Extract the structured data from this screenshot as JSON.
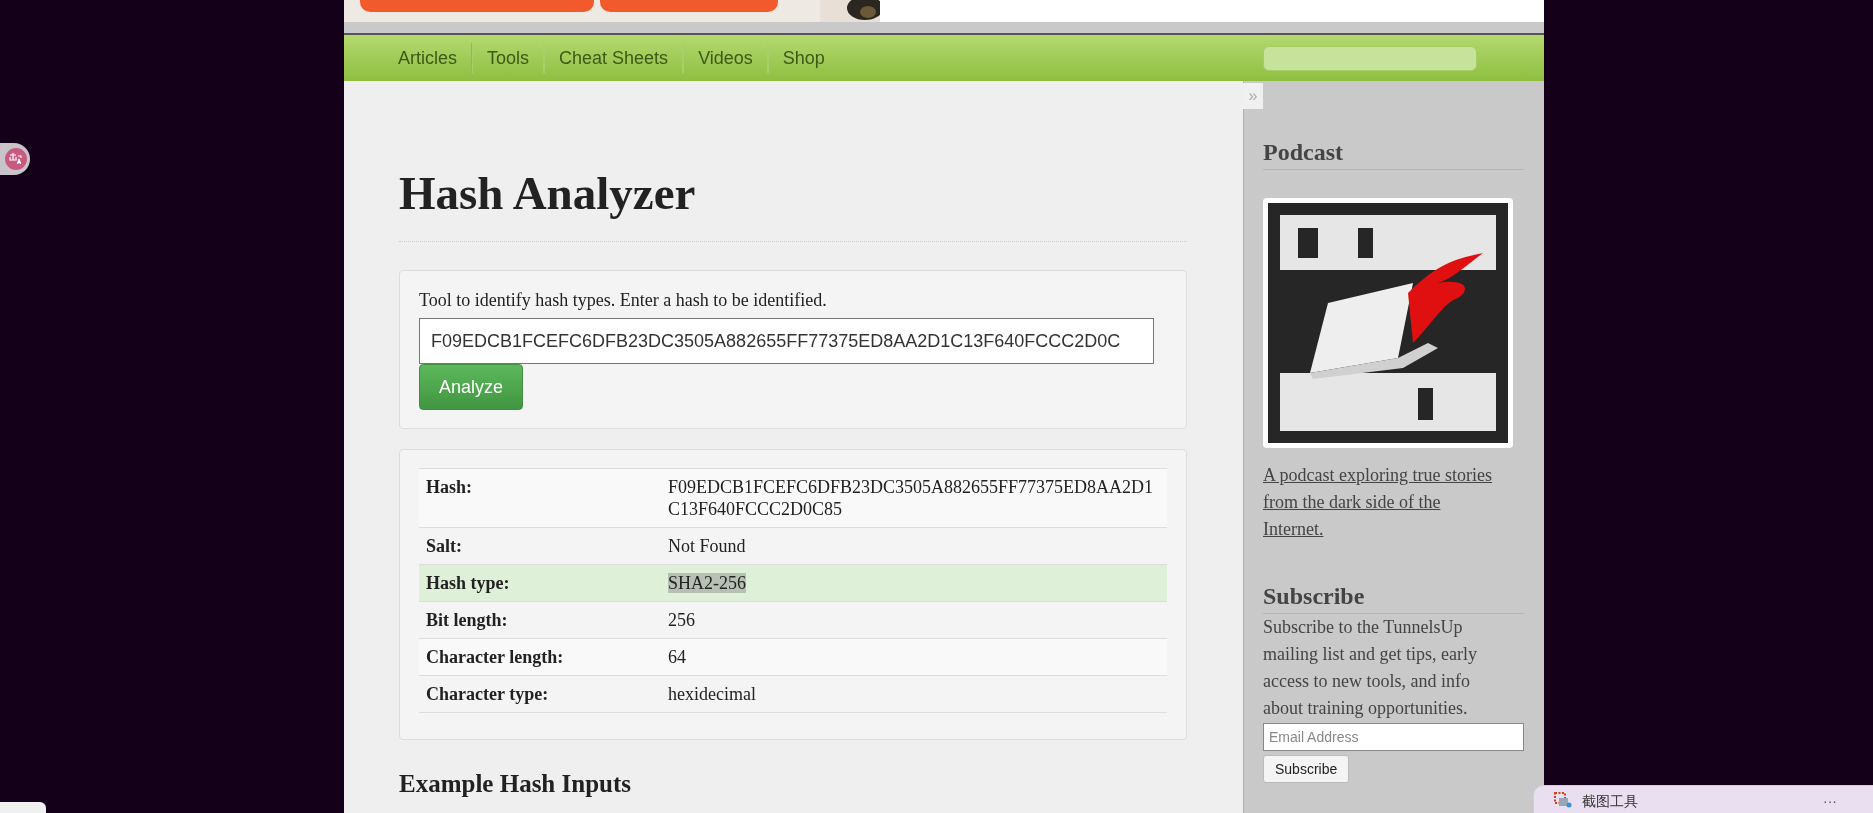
{
  "nav": {
    "items": [
      {
        "label": "Articles"
      },
      {
        "label": "Tools"
      },
      {
        "label": "Cheat Sheets"
      },
      {
        "label": "Videos"
      },
      {
        "label": "Shop"
      }
    ]
  },
  "page": {
    "title": "Hash Analyzer",
    "form": {
      "instructions": "Tool to identify hash types. Enter a hash to be identified.",
      "hash_value": "F09EDCB1FCEFC6DFB23DC3505A882655FF77375ED8AA2D1C13F640FCCC2D0C",
      "button": "Analyze"
    },
    "results": [
      {
        "label": "Hash:",
        "value": "F09EDCB1FCEFC6DFB23DC3505A882655FF77375ED8AA2D1C13F640FCCC2D0C85",
        "selected": false
      },
      {
        "label": "Salt:",
        "value": "Not Found",
        "selected": false
      },
      {
        "label": "Hash type:",
        "value": "SHA2-256",
        "selected": true
      },
      {
        "label": "Bit length:",
        "value": "256",
        "selected": false
      },
      {
        "label": "Character length:",
        "value": "64",
        "selected": false
      },
      {
        "label": "Character type:",
        "value": "hexidecimal",
        "selected": false
      }
    ],
    "examples_heading": "Example Hash Inputs"
  },
  "sidebar": {
    "toggle": "»",
    "podcast_heading": "Podcast",
    "podcast_link": "A podcast exploring true stories from the dark side of the Internet.",
    "subscribe_heading": "Subscribe",
    "subscribe_text": "Subscribe to the TunnelsUp mailing list and get tips, early access to new tools, and info about training opportunities.",
    "email_placeholder": "Email Address",
    "subscribe_button": "Subscribe"
  },
  "notification": {
    "title": "截图工具",
    "more": "···"
  }
}
